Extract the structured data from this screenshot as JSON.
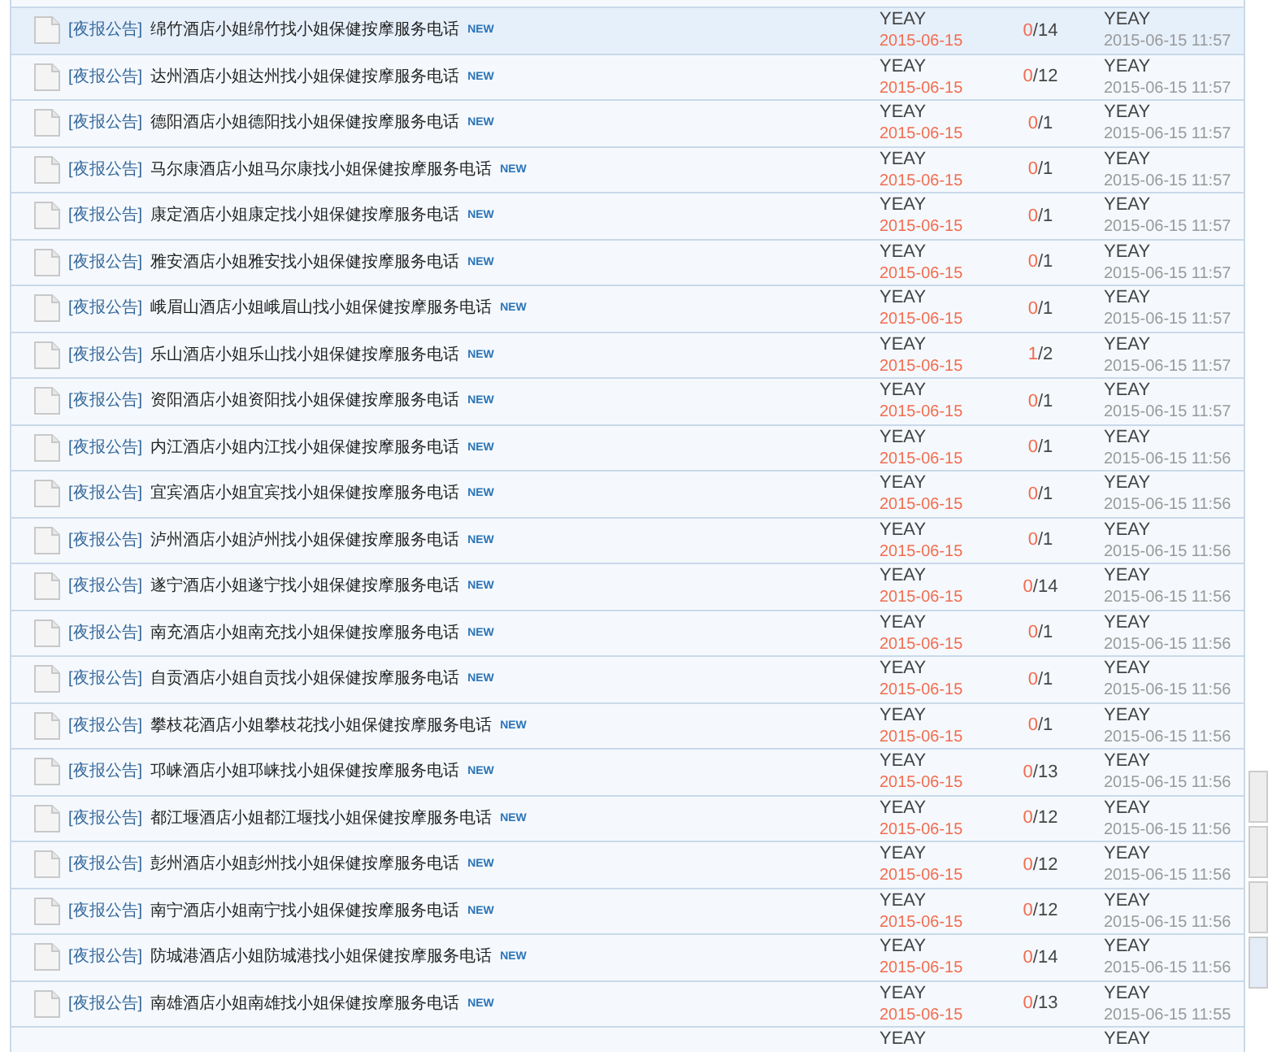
{
  "threads": [
    {
      "category": "[夜报公告]",
      "title": "绵竹酒店小姐绵竹找小姐保健按摩服务电话",
      "badge": "NEW",
      "author": "YEAY",
      "date": "2015-06-15",
      "replies": "0",
      "views": "/14",
      "last_poster": "YEAY",
      "last_time": "2015-06-15 11:57",
      "selected": true
    },
    {
      "category": "[夜报公告]",
      "title": "达州酒店小姐达州找小姐保健按摩服务电话",
      "badge": "NEW",
      "author": "YEAY",
      "date": "2015-06-15",
      "replies": "0",
      "views": "/12",
      "last_poster": "YEAY",
      "last_time": "2015-06-15 11:57",
      "selected": false
    },
    {
      "category": "[夜报公告]",
      "title": "德阳酒店小姐德阳找小姐保健按摩服务电话",
      "badge": "NEW",
      "author": "YEAY",
      "date": "2015-06-15",
      "replies": "0",
      "views": "/1",
      "last_poster": "YEAY",
      "last_time": "2015-06-15 11:57",
      "selected": false
    },
    {
      "category": "[夜报公告]",
      "title": "马尔康酒店小姐马尔康找小姐保健按摩服务电话",
      "badge": "NEW",
      "author": "YEAY",
      "date": "2015-06-15",
      "replies": "0",
      "views": "/1",
      "last_poster": "YEAY",
      "last_time": "2015-06-15 11:57",
      "selected": false
    },
    {
      "category": "[夜报公告]",
      "title": "康定酒店小姐康定找小姐保健按摩服务电话",
      "badge": "NEW",
      "author": "YEAY",
      "date": "2015-06-15",
      "replies": "0",
      "views": "/1",
      "last_poster": "YEAY",
      "last_time": "2015-06-15 11:57",
      "selected": false
    },
    {
      "category": "[夜报公告]",
      "title": "雅安酒店小姐雅安找小姐保健按摩服务电话",
      "badge": "NEW",
      "author": "YEAY",
      "date": "2015-06-15",
      "replies": "0",
      "views": "/1",
      "last_poster": "YEAY",
      "last_time": "2015-06-15 11:57",
      "selected": false
    },
    {
      "category": "[夜报公告]",
      "title": "峨眉山酒店小姐峨眉山找小姐保健按摩服务电话",
      "badge": "NEW",
      "author": "YEAY",
      "date": "2015-06-15",
      "replies": "0",
      "views": "/1",
      "last_poster": "YEAY",
      "last_time": "2015-06-15 11:57",
      "selected": false
    },
    {
      "category": "[夜报公告]",
      "title": "乐山酒店小姐乐山找小姐保健按摩服务电话",
      "badge": "NEW",
      "author": "YEAY",
      "date": "2015-06-15",
      "replies": "1",
      "views": "/2",
      "last_poster": "YEAY",
      "last_time": "2015-06-15 11:57",
      "selected": false
    },
    {
      "category": "[夜报公告]",
      "title": "资阳酒店小姐资阳找小姐保健按摩服务电话",
      "badge": "NEW",
      "author": "YEAY",
      "date": "2015-06-15",
      "replies": "0",
      "views": "/1",
      "last_poster": "YEAY",
      "last_time": "2015-06-15 11:57",
      "selected": false
    },
    {
      "category": "[夜报公告]",
      "title": "内江酒店小姐内江找小姐保健按摩服务电话",
      "badge": "NEW",
      "author": "YEAY",
      "date": "2015-06-15",
      "replies": "0",
      "views": "/1",
      "last_poster": "YEAY",
      "last_time": "2015-06-15 11:56",
      "selected": false
    },
    {
      "category": "[夜报公告]",
      "title": "宜宾酒店小姐宜宾找小姐保健按摩服务电话",
      "badge": "NEW",
      "author": "YEAY",
      "date": "2015-06-15",
      "replies": "0",
      "views": "/1",
      "last_poster": "YEAY",
      "last_time": "2015-06-15 11:56",
      "selected": false
    },
    {
      "category": "[夜报公告]",
      "title": "泸州酒店小姐泸州找小姐保健按摩服务电话",
      "badge": "NEW",
      "author": "YEAY",
      "date": "2015-06-15",
      "replies": "0",
      "views": "/1",
      "last_poster": "YEAY",
      "last_time": "2015-06-15 11:56",
      "selected": false
    },
    {
      "category": "[夜报公告]",
      "title": "遂宁酒店小姐遂宁找小姐保健按摩服务电话",
      "badge": "NEW",
      "author": "YEAY",
      "date": "2015-06-15",
      "replies": "0",
      "views": "/14",
      "last_poster": "YEAY",
      "last_time": "2015-06-15 11:56",
      "selected": false
    },
    {
      "category": "[夜报公告]",
      "title": "南充酒店小姐南充找小姐保健按摩服务电话",
      "badge": "NEW",
      "author": "YEAY",
      "date": "2015-06-15",
      "replies": "0",
      "views": "/1",
      "last_poster": "YEAY",
      "last_time": "2015-06-15 11:56",
      "selected": false
    },
    {
      "category": "[夜报公告]",
      "title": "自贡酒店小姐自贡找小姐保健按摩服务电话",
      "badge": "NEW",
      "author": "YEAY",
      "date": "2015-06-15",
      "replies": "0",
      "views": "/1",
      "last_poster": "YEAY",
      "last_time": "2015-06-15 11:56",
      "selected": false
    },
    {
      "category": "[夜报公告]",
      "title": "攀枝花酒店小姐攀枝花找小姐保健按摩服务电话",
      "badge": "NEW",
      "author": "YEAY",
      "date": "2015-06-15",
      "replies": "0",
      "views": "/1",
      "last_poster": "YEAY",
      "last_time": "2015-06-15 11:56",
      "selected": false
    },
    {
      "category": "[夜报公告]",
      "title": "邛崃酒店小姐邛崃找小姐保健按摩服务电话",
      "badge": "NEW",
      "author": "YEAY",
      "date": "2015-06-15",
      "replies": "0",
      "views": "/13",
      "last_poster": "YEAY",
      "last_time": "2015-06-15 11:56",
      "selected": false
    },
    {
      "category": "[夜报公告]",
      "title": "都江堰酒店小姐都江堰找小姐保健按摩服务电话",
      "badge": "NEW",
      "author": "YEAY",
      "date": "2015-06-15",
      "replies": "0",
      "views": "/12",
      "last_poster": "YEAY",
      "last_time": "2015-06-15 11:56",
      "selected": false
    },
    {
      "category": "[夜报公告]",
      "title": "彭州酒店小姐彭州找小姐保健按摩服务电话",
      "badge": "NEW",
      "author": "YEAY",
      "date": "2015-06-15",
      "replies": "0",
      "views": "/12",
      "last_poster": "YEAY",
      "last_time": "2015-06-15 11:56",
      "selected": false
    },
    {
      "category": "[夜报公告]",
      "title": "南宁酒店小姐南宁找小姐保健按摩服务电话",
      "badge": "NEW",
      "author": "YEAY",
      "date": "2015-06-15",
      "replies": "0",
      "views": "/12",
      "last_poster": "YEAY",
      "last_time": "2015-06-15 11:56",
      "selected": false
    },
    {
      "category": "[夜报公告]",
      "title": "防城港酒店小姐防城港找小姐保健按摩服务电话",
      "badge": "NEW",
      "author": "YEAY",
      "date": "2015-06-15",
      "replies": "0",
      "views": "/14",
      "last_poster": "YEAY",
      "last_time": "2015-06-15 11:56",
      "selected": false
    },
    {
      "category": "[夜报公告]",
      "title": "南雄酒店小姐南雄找小姐保健按摩服务电话",
      "badge": "NEW",
      "author": "YEAY",
      "date": "2015-06-15",
      "replies": "0",
      "views": "/13",
      "last_poster": "YEAY",
      "last_time": "2015-06-15 11:55",
      "selected": false
    },
    {
      "author": "YEAY",
      "last_poster": "YEAY",
      "selected": false
    }
  ]
}
